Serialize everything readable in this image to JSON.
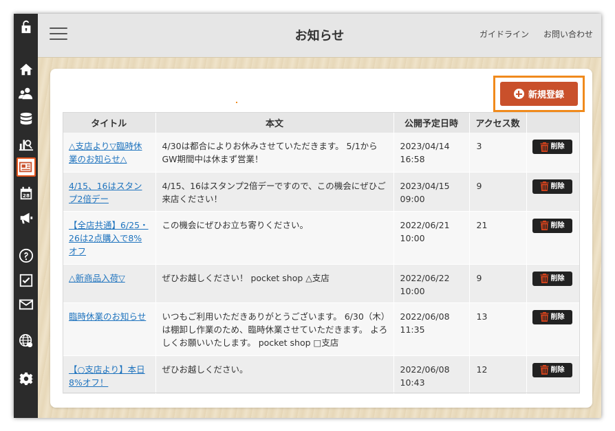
{
  "header": {
    "title": "お知らせ",
    "links": [
      "ガイドライン",
      "お問い合わせ"
    ]
  },
  "toolbar": {
    "new_label": "新規登録"
  },
  "table": {
    "columns": [
      "タイトル",
      "本文",
      "公開予定日時",
      "アクセス数",
      ""
    ],
    "delete_label": "削除",
    "rows": [
      {
        "title": "△支店より▽臨時休業のお知らせ△",
        "body": "4/30は都合によりお休みさせていただきます。 5/1からGW期間中は休まず営業！",
        "date": "2023/04/14 16:58",
        "access": "3"
      },
      {
        "title": "4/15、16はスタンプ2倍デー",
        "body": "4/15、16はスタンプ2倍デーですので、この機会にぜひご来店ください！",
        "date": "2023/04/15 09:00",
        "access": "9"
      },
      {
        "title": "【全店共通】6/25・26は2点購入で8%オフ",
        "body": "この機会にぜひお立ち寄りください。",
        "date": "2022/06/21 10:00",
        "access": "21"
      },
      {
        "title": "△新商品入荷▽",
        "body": "ぜひお越しください！ pocket shop △支店",
        "date": "2022/06/22 10:00",
        "access": "9"
      },
      {
        "title": "臨時休業のお知らせ",
        "body": "いつもご利用いただきありがとうございます。 6/30（木）は棚卸し作業のため、臨時休業させていただきます。 よろしくお願いいたします。 pocket shop □支店",
        "date": "2022/06/08 11:35",
        "access": "13"
      },
      {
        "title": "【○支店より】本日8%オフ！",
        "body": "ぜひお越しください。",
        "date": "2022/06/08 10:43",
        "access": "12"
      }
    ]
  },
  "colors": {
    "accent": "#c9502b",
    "highlight": "#f08a1c",
    "sidebar": "#2b2b2b",
    "link": "#1e73be"
  },
  "sidebar_icons": [
    "unlock-icon",
    "home-icon",
    "users-icon",
    "database-icon",
    "analytics-icon",
    "news-icon",
    "calendar-icon",
    "megaphone-icon",
    "help-icon",
    "checkbox-icon",
    "mail-icon",
    "globe-icon",
    "gear-icon"
  ]
}
